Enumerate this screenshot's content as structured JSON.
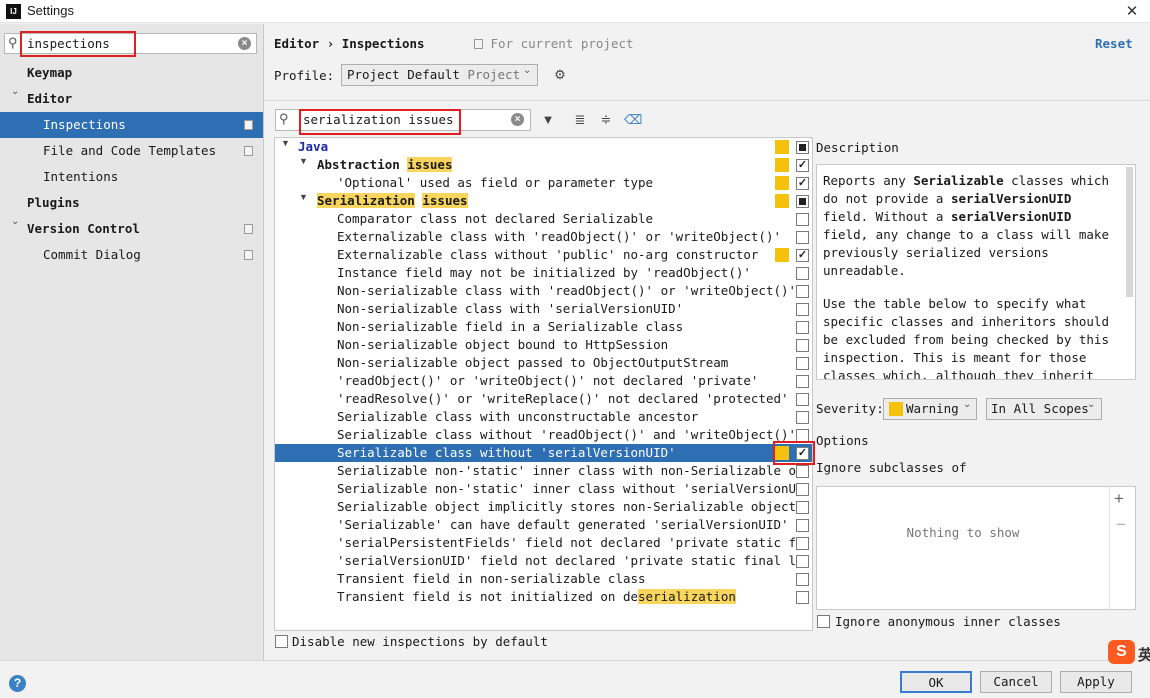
{
  "window": {
    "title": "Settings",
    "close": "✕",
    "app_icon": "IJ"
  },
  "sidebar": {
    "search_value": "inspections",
    "items": [
      {
        "label": "Keymap"
      },
      {
        "label": "Editor"
      },
      {
        "label": "Inspections"
      },
      {
        "label": "File and Code Templates"
      },
      {
        "label": "Intentions"
      },
      {
        "label": "Plugins"
      },
      {
        "label": "Version Control"
      },
      {
        "label": "Commit Dialog"
      }
    ]
  },
  "header": {
    "crumb1": "Editor",
    "crumb_sep": "›",
    "crumb2": "Inspections",
    "scope_note": "For current project",
    "reset": "Reset"
  },
  "profile": {
    "label": "Profile:",
    "name": "Project Default",
    "type": "Project"
  },
  "filter": {
    "value": "serialization issues"
  },
  "tree": {
    "java": "Java",
    "abstraction": "Abstraction",
    "issues": "issues",
    "serialization": "Serialization",
    "optional_item": "'Optional' used as field or parameter type",
    "items": [
      "Comparator class not declared Serializable",
      "Externalizable class with 'readObject()' or 'writeObject()'",
      "Externalizable class without 'public' no-arg constructor",
      "Instance field may not be initialized by 'readObject()'",
      "Non-serializable class with 'readObject()' or 'writeObject()'",
      "Non-serializable class with 'serialVersionUID'",
      "Non-serializable field in a Serializable class",
      "Non-serializable object bound to HttpSession",
      "Non-serializable object passed to ObjectOutputStream",
      "'readObject()' or 'writeObject()' not declared 'private'",
      "'readResolve()' or 'writeReplace()' not declared 'protected'",
      "Serializable class with unconstructable ancestor",
      "Serializable class without 'readObject()' and 'writeObject()'",
      "Serializable class without 'serialVersionUID'",
      "Serializable non-'static' inner class with non-Serializable ou",
      "Serializable non-'static' inner class without 'serialVersionUI",
      "Serializable object implicitly stores non-Serializable object",
      "'Serializable' can have default generated 'serialVersionUID'",
      "'serialPersistentFields' field not declared 'private static fi",
      "'serialVersionUID' field not declared 'private static final lo",
      "Transient field in non-serializable class"
    ],
    "last_prefix": "Transient field is not initialized on de",
    "last_hl": "serialization"
  },
  "disable_new": "Disable new inspections by default",
  "description": {
    "title": "Description",
    "p1": [
      "Reports any ",
      {
        "b": "Serializable"
      },
      " classes which do not provide a ",
      {
        "b": "serialVersionUID"
      },
      " field. Without a ",
      {
        "b": "serialVersionUID"
      },
      " field, any change to a class will make previously serialized versions unreadable."
    ],
    "p2": "Use the table below to specify what specific classes and inheritors should be excluded from being checked by this inspection. This is meant for those classes which, although they inherit"
  },
  "severity": {
    "label": "Severity:",
    "value": "Warning",
    "scope": "In All Scopes"
  },
  "options": {
    "title": "Options",
    "ignore_sub": "Ignore subclasses of",
    "empty": "Nothing to show",
    "plus": "+",
    "minus": "−",
    "ignore_anon": "Ignore anonymous inner classes"
  },
  "buttons": {
    "ok": "OK",
    "cancel": "Cancel",
    "apply": "Apply"
  },
  "ime": "S",
  "ime_text": "英",
  "colors": {
    "warning": "#f4c20d",
    "selection": "#2e6fb4",
    "link": "#2f6fb6",
    "java": "#1a2aa8"
  }
}
